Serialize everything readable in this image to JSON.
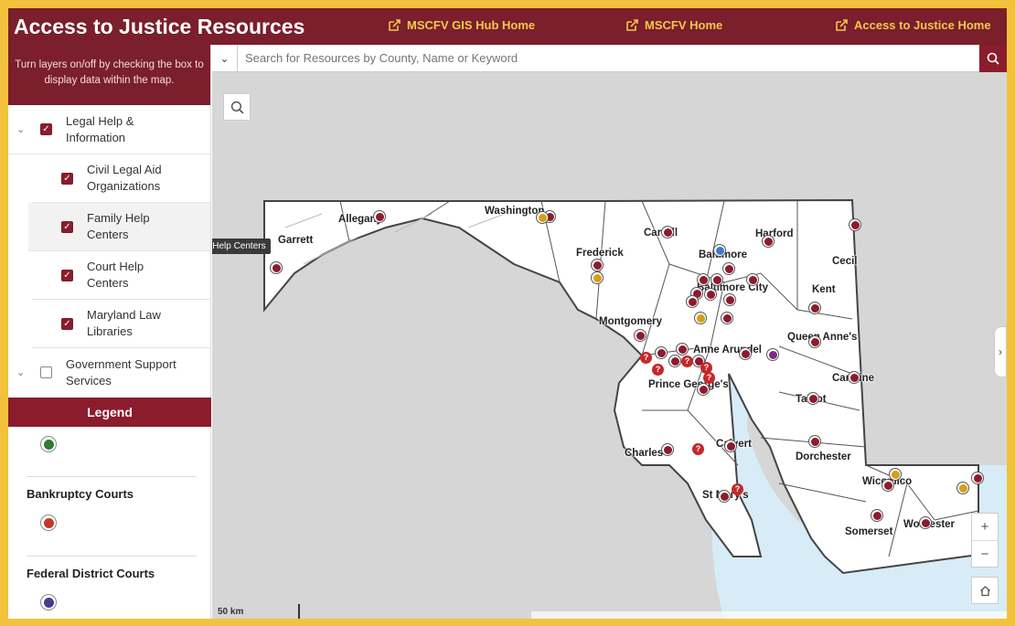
{
  "header": {
    "title": "Access to Justice Resources",
    "links": [
      "MSCFV GIS Hub Home",
      "MSCFV Home",
      "Access to Justice Home"
    ]
  },
  "sidebar": {
    "instructions": "Turn layers on/off by checking the box to display data within the map.",
    "layers": [
      {
        "label": "Legal Help & Information",
        "checked": true
      },
      {
        "label": "Civil Legal Aid Organizations",
        "checked": true
      },
      {
        "label": "Family Help Centers",
        "checked": true
      },
      {
        "label": "Court Help Centers",
        "checked": true
      },
      {
        "label": "Maryland Law Libraries",
        "checked": true
      },
      {
        "label": "Government Support Services",
        "checked": false
      }
    ],
    "legend_title": "Legend",
    "legend_items": [
      {
        "title": "",
        "color": "#2e7d32"
      },
      {
        "title": "Bankruptcy Courts",
        "color": "#c0392b"
      },
      {
        "title": "Federal District Courts",
        "color": "#4a3a8c"
      }
    ]
  },
  "map": {
    "search_placeholder": "Search for Resources by County, Name or Keyword",
    "tooltip": "Family Help Centers",
    "scale": "50 km",
    "counties": [
      "Washington",
      "Allegany",
      "Garrett",
      "Frederick",
      "Carroll",
      "Baltimore",
      "Harford",
      "Cecil",
      "Baltimore City",
      "Kent",
      "Montgomery",
      "Queen Anne's",
      "Anne Arundel",
      "Prince George's",
      "Caroline",
      "Talbot",
      "Calvert",
      "Charles",
      "Dorchester",
      "St Mary's",
      "Wicomico",
      "Somerset",
      "Worcester"
    ],
    "zoom_in": "+",
    "zoom_out": "−"
  },
  "colors": {
    "brand": "#7a1f2b",
    "accent": "#f2c84b",
    "marker_maroon": "#8b1c2c",
    "marker_gold": "#d4a017",
    "marker_purple": "#7b2a8c",
    "marker_blue": "#3f7bbf",
    "marker_red": "#c62828"
  }
}
